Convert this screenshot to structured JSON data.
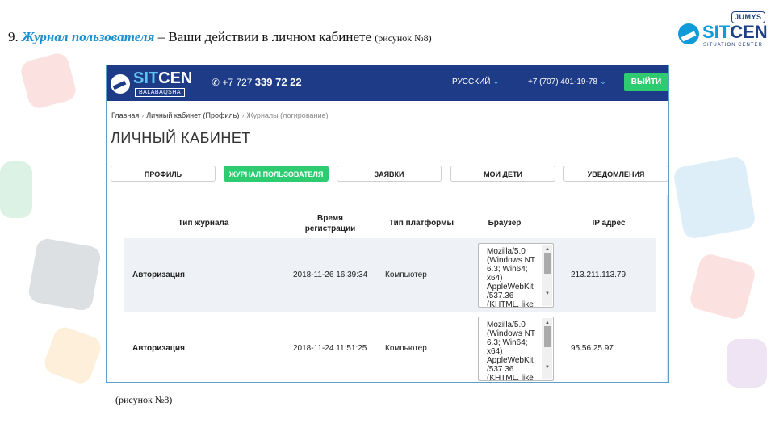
{
  "slide": {
    "title_num": "9. ",
    "title_highlight": "Журнал пользователя",
    "title_rest": " – Ваши действии в личном кабинете ",
    "title_ref": "(рисунок №8)",
    "caption": "(рисунок №8)"
  },
  "brand_logo": {
    "badge": "JUMYS",
    "name_a": "SIT",
    "name_b": "CEN",
    "sub": "SITUATION CENTER"
  },
  "site": {
    "logo_a": "SIT",
    "logo_b": "CEN",
    "logo_sub": "BALABAQSHA",
    "phone_prefix": "+7 727 ",
    "phone_main": "339 72 22",
    "language": "РУССКИЙ",
    "phone2": "+7 (707) 401-19-78",
    "login_label": "ВЫЙТИ"
  },
  "breadcrumb": [
    "Главная",
    "Личный кабинет (Профиль)",
    "Журналы (логирование)"
  ],
  "page_title": "ЛИЧНЫЙ КАБИНЕТ",
  "tabs": [
    {
      "label": "ПРОФИЛЬ",
      "active": false
    },
    {
      "label": "ЖУРНАЛ ПОЛЬЗОВАТЕЛЯ",
      "active": true
    },
    {
      "label": "ЗАЯВКИ",
      "active": false
    },
    {
      "label": "МОИ ДЕТИ",
      "active": false
    },
    {
      "label": "УВЕДОМЛЕНИЯ",
      "active": false
    }
  ],
  "table": {
    "columns": [
      "Тип журнала",
      "Время регистрации",
      "Тип платформы",
      "Браузер",
      "IP адрес"
    ],
    "rows": [
      {
        "type": "Авторизация",
        "time": "2018-11-26 16:39:34",
        "platform": "Компьютер",
        "browser": "Mozilla/5.0 (Windows NT 6.3; Win64; x64) AppleWebKit /537.36 (KHTML, like",
        "ip": "213.211.113.79"
      },
      {
        "type": "Авторизация",
        "time": "2018-11-24 11:51:25",
        "platform": "Компьютер",
        "browser": "Mozilla/5.0 (Windows NT 6.3; Win64; x64) AppleWebKit /537.36 (KHTML, like",
        "ip": "95.56.25.97"
      }
    ]
  },
  "colors": {
    "navbar": "#1d3b86",
    "accent_green": "#2ecc71",
    "title_blue": "#1a8fd0"
  }
}
